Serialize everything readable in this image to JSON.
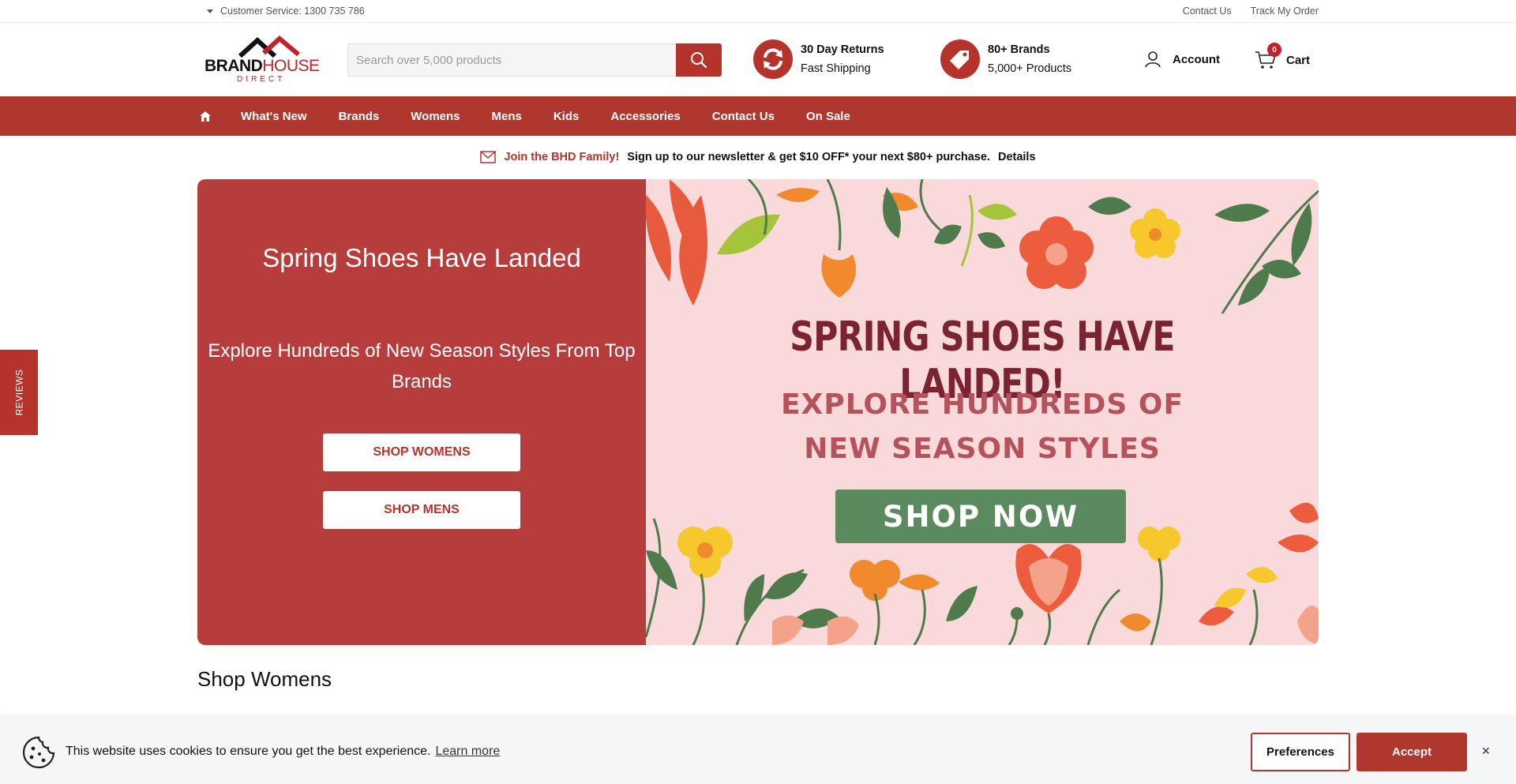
{
  "topbar": {
    "customer_service": "Customer Service: 1300 735 786",
    "links": [
      "Contact Us",
      "Track My Order"
    ]
  },
  "logo": {
    "brand_part1": "BRAND",
    "brand_part2": "HOUSE",
    "sub": "DIRECT"
  },
  "search": {
    "placeholder": "Search over 5,000 products",
    "icon": "search-icon"
  },
  "usps": [
    {
      "line1": "30 Day Returns",
      "line2": "Fast Shipping",
      "icon": "refresh-icon"
    },
    {
      "line1": "80+ Brands",
      "line2": "5,000+ Products",
      "icon": "tag-icon"
    }
  ],
  "account": {
    "label": "Account",
    "icon": "user-icon"
  },
  "cart": {
    "label": "Cart",
    "count": "0",
    "icon": "cart-icon"
  },
  "nav": {
    "home_icon": "home-icon",
    "items": [
      "What's New",
      "Brands",
      "Womens",
      "Mens",
      "Kids",
      "Accessories",
      "Contact Us",
      "On Sale"
    ]
  },
  "newsletter": {
    "icon": "mail-icon",
    "join": "Join the BHD Family!",
    "message": "Sign up to our newsletter & get $10 OFF* your next $80+ purchase.",
    "details": "Details"
  },
  "hero": {
    "headline": "Spring Shoes Have Landed",
    "subheadline": "Explore Hundreds of New Season Styles From Top Brands",
    "cta_womens": "SHOP WOMENS",
    "cta_mens": "SHOP MENS",
    "banner_title": "SPRING SHOES HAVE LANDED!",
    "banner_sub_line1": "EXPLORE HUNDREDS OF",
    "banner_sub_line2": "NEW SEASON STYLES",
    "banner_cta": "SHOP NOW"
  },
  "section": {
    "title": "Shop Womens"
  },
  "reviews_tab": {
    "label": "REVIEWS"
  },
  "cookie": {
    "icon": "cookie-icon",
    "text": "This website uses cookies to ensure you get the best experience.",
    "learn_more": "Learn more",
    "preferences": "Preferences",
    "accept": "Accept",
    "close": "✕"
  },
  "colors": {
    "brand_red": "#b0372e",
    "hero_red": "#b73c3c",
    "banner_pink": "#f9d9d9",
    "banner_green": "#5a8a5e"
  }
}
